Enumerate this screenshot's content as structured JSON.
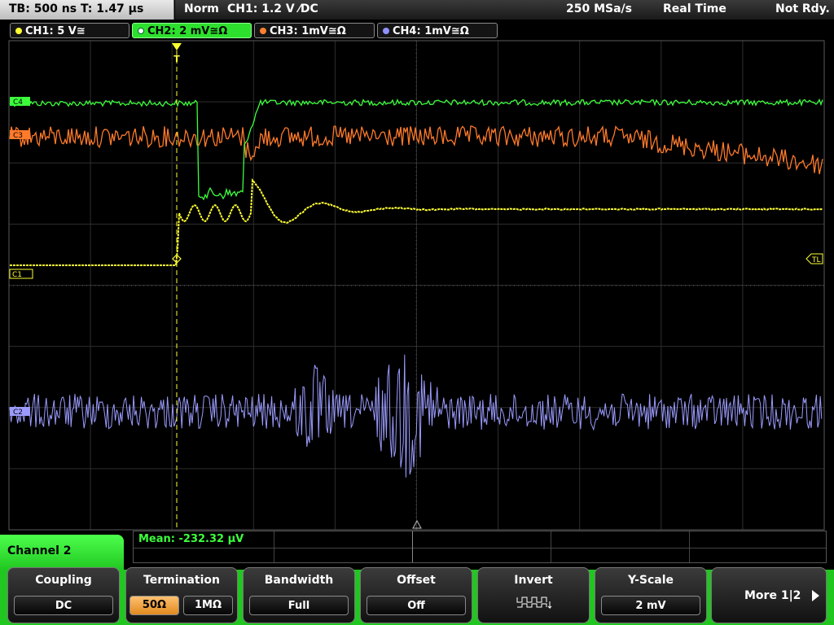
{
  "status_bar": {
    "timebase": "TB: 500 ns",
    "trigger_time": "T: 1.47 µs",
    "trigger_mode": "Norm",
    "trigger_source": "CH1: 1.2 V ⁄DC",
    "sample_rate": "250 MSa/s",
    "acq_mode": "Real Time",
    "run_state": "Not Rdy."
  },
  "channel_tabs": [
    {
      "label": "CH1: 5 V≅",
      "color": "#ffff33",
      "active": false
    },
    {
      "label": "CH2: 2 mV≅Ω",
      "color": "#3cff3c",
      "active": true
    },
    {
      "label": "CH3: 1mV≅Ω",
      "color": "#ff8030",
      "active": false
    },
    {
      "label": "CH4: 1mV≅Ω",
      "color": "#9090ff",
      "active": false
    }
  ],
  "markers": {
    "c4": "C4",
    "c3": "C3",
    "c1": "C1",
    "c2": "C2",
    "trigger_level": "TL",
    "trigger_pos": "T"
  },
  "colors": {
    "ch1": "#ffff33",
    "ch2": "#3cff3c",
    "ch3": "#ff7a2a",
    "ch4": "#9b9bff",
    "grid": "#3a3a3a",
    "accent_green": "#21c621"
  },
  "measurement": {
    "mean": "Mean: -232.32 µV"
  },
  "panel": {
    "title": "Channel 2",
    "softkeys": [
      {
        "title": "Coupling",
        "value": "DC"
      },
      {
        "title": "Termination",
        "options": [
          "50Ω",
          "1MΩ"
        ],
        "selected": "50Ω"
      },
      {
        "title": "Bandwidth",
        "value": "Full"
      },
      {
        "title": "Offset",
        "value": "Off"
      },
      {
        "title": "Invert",
        "icon": "invert-waveform-icon"
      },
      {
        "title": "Y-Scale",
        "value": "2 mV"
      }
    ],
    "more": "More 1|2"
  }
}
